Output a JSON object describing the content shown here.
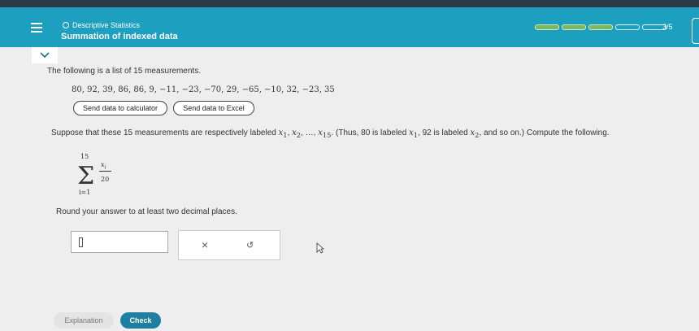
{
  "header": {
    "topic": "Descriptive Statistics",
    "title": "Summation of indexed data",
    "progress": {
      "completed": 3,
      "total": 5,
      "label": "3/5"
    }
  },
  "problem": {
    "intro": "The following is a list of 15 measurements.",
    "data_list": "80, 92, 39, 86, 86, 9, −11, −23, −70, 29, −65, −10, 32, −23, 35",
    "send_calculator_label": "Send data to calculator",
    "send_excel_label": "Send data to Excel",
    "instruction": {
      "a": "Suppose that these 15 measurements are respectively labeled",
      "x": "x",
      "i1": "1",
      "i2": "2",
      "sep": ", …,",
      "i15": "15",
      "thus": ". (Thus, 80 is labeled",
      "comma92": ", 92 is labeled",
      "tail": ", and so on.) Compute the following."
    },
    "formula": {
      "upper": "15",
      "lower": "i=1",
      "sigma": "Σ",
      "numerator": "x",
      "numerator_sub": "i",
      "denominator": "20"
    },
    "round_note": "Round your answer to at least two decimal places."
  },
  "answer": {
    "value": "",
    "clear_symbol": "×",
    "undo_symbol": "↺"
  },
  "footer": {
    "explanation_label": "Explanation",
    "check_label": "Check"
  },
  "colors": {
    "header": "#1d9fc0",
    "progress_filled": "#7bb663",
    "check_button": "#1f7fa0"
  }
}
